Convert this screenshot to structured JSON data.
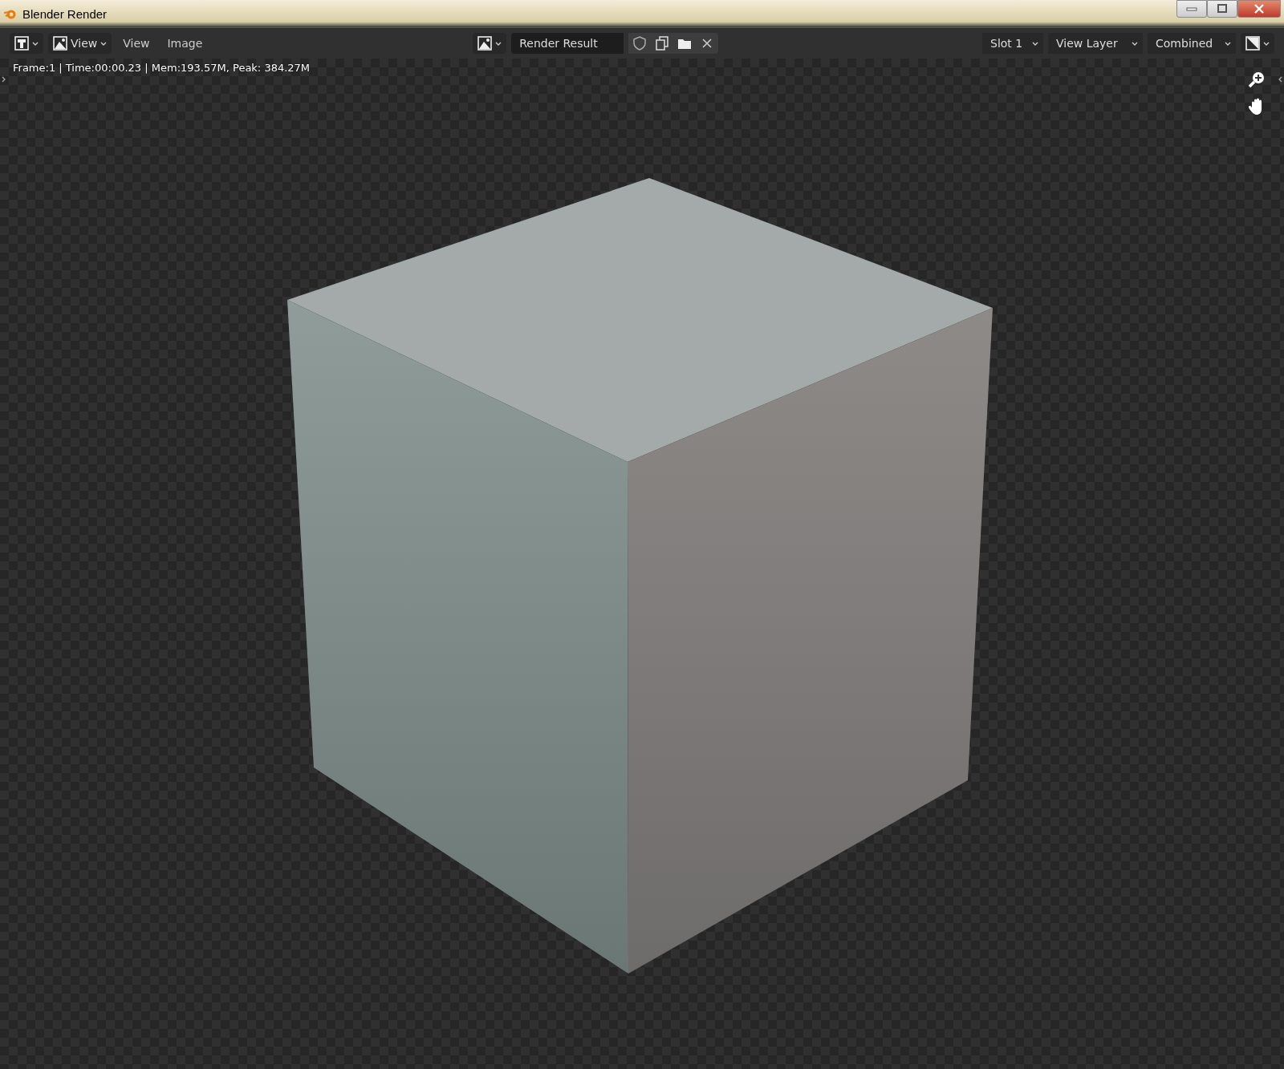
{
  "window": {
    "title": "Blender Render"
  },
  "header": {
    "view_dropdown": "View",
    "menus": [
      "View",
      "Image"
    ],
    "image_name": "Render Result",
    "slot": "Slot 1",
    "view_layer": "View Layer",
    "pass": "Combined"
  },
  "viewer": {
    "render_stats": "Frame:1 | Time:00:00.23 | Mem:193.57M, Peak: 384.27M"
  }
}
